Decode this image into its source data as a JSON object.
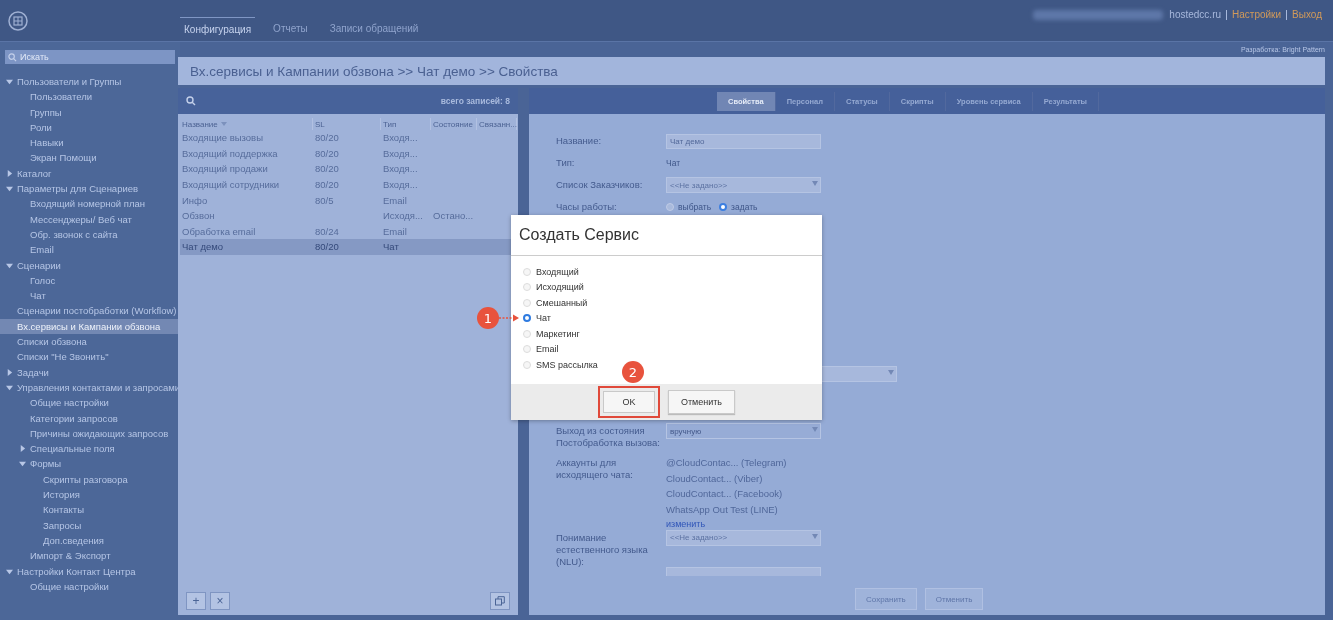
{
  "header": {
    "tabs": [
      {
        "label": "Конфигурация",
        "selected": true
      },
      {
        "label": "Отчеты",
        "selected": false
      },
      {
        "label": "Записи обращений",
        "selected": false
      }
    ],
    "domain": "hostedcc.ru",
    "links": [
      "Настройки",
      "Выход"
    ],
    "developer": "Разработка: Bright Pattern"
  },
  "sidebar": {
    "search": {
      "placeholder": "Искать"
    },
    "tree": [
      {
        "label": "Пользователи и Группы",
        "expanded": true,
        "selected": false,
        "children": [
          {
            "label": "Пользователи",
            "selected": false
          },
          {
            "label": "Группы",
            "selected": false
          },
          {
            "label": "Роли",
            "selected": false
          },
          {
            "label": "Навыки",
            "selected": false
          },
          {
            "label": "Экран Помощи",
            "selected": false
          }
        ]
      },
      {
        "label": "Каталог",
        "expanded": false,
        "selected": false
      },
      {
        "label": "Параметры для Сценариев",
        "expanded": true,
        "selected": false,
        "children": [
          {
            "label": "Входящий номерной план",
            "selected": false
          },
          {
            "label": "Мессенджеры/ Веб чат",
            "selected": false
          },
          {
            "label": "Обр. звонок с сайта",
            "selected": false
          },
          {
            "label": "Email",
            "selected": false
          }
        ]
      },
      {
        "label": "Сценарии",
        "expanded": true,
        "selected": false,
        "children": [
          {
            "label": "Голос",
            "selected": false
          },
          {
            "label": "Чат",
            "selected": false
          }
        ]
      },
      {
        "label": "Сценарии постобработки (Workflow)",
        "selected": false
      },
      {
        "label": "Вх.сервисы и Кампании обзвона",
        "selected": true
      },
      {
        "label": "Списки обзвона",
        "selected": false
      },
      {
        "label": "Списки \"Не Звонить\"",
        "selected": false
      },
      {
        "label": "Задачи",
        "expanded": false,
        "selected": false
      },
      {
        "label": "Управления контактами и запросами",
        "expanded": true,
        "selected": false,
        "children": [
          {
            "label": "Общие настройки",
            "selected": false
          },
          {
            "label": "Категории запросов",
            "selected": false
          },
          {
            "label": "Причины ожидающих запросов",
            "selected": false
          },
          {
            "label": "Специальные поля",
            "expanded": false,
            "selected": false
          },
          {
            "label": "Формы",
            "expanded": true,
            "selected": false,
            "children": [
              {
                "label": "Скрипты разговора",
                "selected": false
              },
              {
                "label": "История",
                "selected": false
              },
              {
                "label": "Контакты",
                "selected": false
              },
              {
                "label": "Запросы",
                "selected": false
              },
              {
                "label": "Доп.сведения",
                "selected": false
              }
            ]
          },
          {
            "label": "Импорт & Экспорт",
            "selected": false
          }
        ]
      },
      {
        "label": "Настройки Контакт Центра",
        "expanded": true,
        "selected": false,
        "children": [
          {
            "label": "Общие настройки",
            "selected": false
          }
        ]
      }
    ]
  },
  "breadcrumb": "Вх.сервисы и Кампании обзвона >> Чат демо >> Свойства",
  "list": {
    "total": "всего записей: 8",
    "columns": [
      "Название",
      "SL",
      "Тип",
      "Состояние",
      "Связанн..."
    ],
    "rows": [
      {
        "cells": [
          "Входящие вызовы",
          "80/20",
          "Входя...",
          "",
          ""
        ],
        "selected": false
      },
      {
        "cells": [
          "Входящий поддержка",
          "80/20",
          "Входя...",
          "",
          ""
        ],
        "selected": false
      },
      {
        "cells": [
          "Входящий продажи",
          "80/20",
          "Входя...",
          "",
          ""
        ],
        "selected": false
      },
      {
        "cells": [
          "Входящий сотрудники",
          "80/20",
          "Входя...",
          "",
          ""
        ],
        "selected": false
      },
      {
        "cells": [
          "Инфо",
          "80/5",
          "Email",
          "",
          ""
        ],
        "selected": false
      },
      {
        "cells": [
          "Обзвон",
          "",
          "Исходя...",
          "Остано...",
          ""
        ],
        "selected": false
      },
      {
        "cells": [
          "Обработка email",
          "80/24",
          "Email",
          "",
          ""
        ],
        "selected": false
      },
      {
        "cells": [
          "Чат демо",
          "80/20",
          "Чат",
          "",
          ""
        ],
        "selected": true
      }
    ],
    "buttons": [
      "+",
      "×"
    ]
  },
  "details": {
    "tabs": [
      {
        "label": "Свойства",
        "selected": true
      },
      {
        "label": "Персонал",
        "selected": false
      },
      {
        "label": "Статусы",
        "selected": false
      },
      {
        "label": "Скрипты",
        "selected": false
      },
      {
        "label": "Уровень сервиса",
        "selected": false
      },
      {
        "label": "Результаты",
        "selected": false
      }
    ],
    "form_top": [
      {
        "kind": "input",
        "label": "Название:",
        "value": "Чат демо"
      },
      {
        "kind": "text",
        "label": "Тип:",
        "value": "Чат"
      },
      {
        "kind": "select",
        "label": "Список Заказчиков:",
        "value": "<<Не задано>>",
        "disabled": false
      },
      {
        "kind": "radio",
        "label": "Часы работы:",
        "options": [
          {
            "label": "выбрать",
            "selected": false
          },
          {
            "label": "задать",
            "selected": true
          }
        ]
      }
    ],
    "form_bottom": [
      {
        "kind": "select",
        "label": "Выход из состояния Постобработка вызова:",
        "value": "вручную",
        "disabled": true
      },
      {
        "kind": "list",
        "label": "Аккаунты для исходящего чата:",
        "items": [
          "@CloudContac... (Telegram)",
          "CloudContact... (Viber)",
          "CloudContact... (Facebook)",
          "WhatsApp Out Test (LINE)"
        ],
        "link": "изменить"
      },
      {
        "kind": "select",
        "label": "Понимание естественного языка (NLU):",
        "value": "<<Не задано>>",
        "disabled": false
      }
    ],
    "actions": [
      {
        "label": "Сохранить",
        "disabled": true
      },
      {
        "label": "Отменить",
        "disabled": true
      }
    ]
  },
  "dialog": {
    "title": "Создать Сервис",
    "options": [
      {
        "label": "Входящий",
        "selected": false
      },
      {
        "label": "Исходящий",
        "selected": false
      },
      {
        "label": "Смешанный",
        "selected": false
      },
      {
        "label": "Чат",
        "selected": true
      },
      {
        "label": "Маркетинг",
        "selected": false
      },
      {
        "label": "Email",
        "selected": false
      },
      {
        "label": "SMS рассылка",
        "selected": false
      }
    ],
    "buttons": [
      {
        "label": "OK",
        "highlighted": true
      },
      {
        "label": "Отменить",
        "highlighted": false
      }
    ]
  },
  "annotations": [
    {
      "label": "1"
    },
    {
      "label": "2"
    }
  ]
}
